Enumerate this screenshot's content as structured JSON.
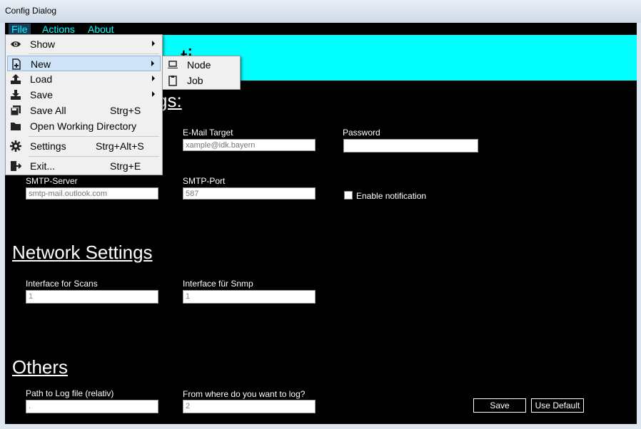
{
  "window": {
    "title": "Config Dialog"
  },
  "menubar": {
    "file": "File",
    "actions": "Actions",
    "about": "About"
  },
  "banner": {
    "title": "ti"
  },
  "sections": {
    "mail": "gs:",
    "network": "Network Settings",
    "others": "Others"
  },
  "mail": {
    "email_target_label": "E-Mail Target",
    "email_target_placeholder": "xample@idk.bayern",
    "password_label": "Password",
    "password_value": "",
    "smtp_server_label": "SMTP-Server",
    "smtp_server_placeholder": "smtp-mail.outlook.com",
    "smtp_port_label": "SMTP-Port",
    "smtp_port_placeholder": "587",
    "notification_label": "Enable notification",
    "notification_checked": false
  },
  "network": {
    "scan_interface_label": "Interface for Scans",
    "scan_interface_value": "1",
    "snmp_interface_label": "Interface für Snmp",
    "snmp_interface_value": "1"
  },
  "others": {
    "log_path_label": "Path to Log file (relativ)",
    "log_path_value": ".",
    "log_from_label": "From where do you want to log?",
    "log_from_value": "2"
  },
  "buttons": {
    "save": "Save",
    "use_default": "Use Default"
  },
  "file_menu": {
    "show": "Show",
    "new": "New",
    "load": "Load",
    "save": "Save",
    "save_all": "Save All",
    "save_all_shortcut": "Strg+S",
    "open_working_dir": "Open Working Directory",
    "settings": "Settings",
    "settings_shortcut": "Strg+Alt+S",
    "exit": "Exit...",
    "exit_shortcut": "Strg+E"
  },
  "new_submenu": {
    "node": "Node",
    "job": "Job"
  }
}
